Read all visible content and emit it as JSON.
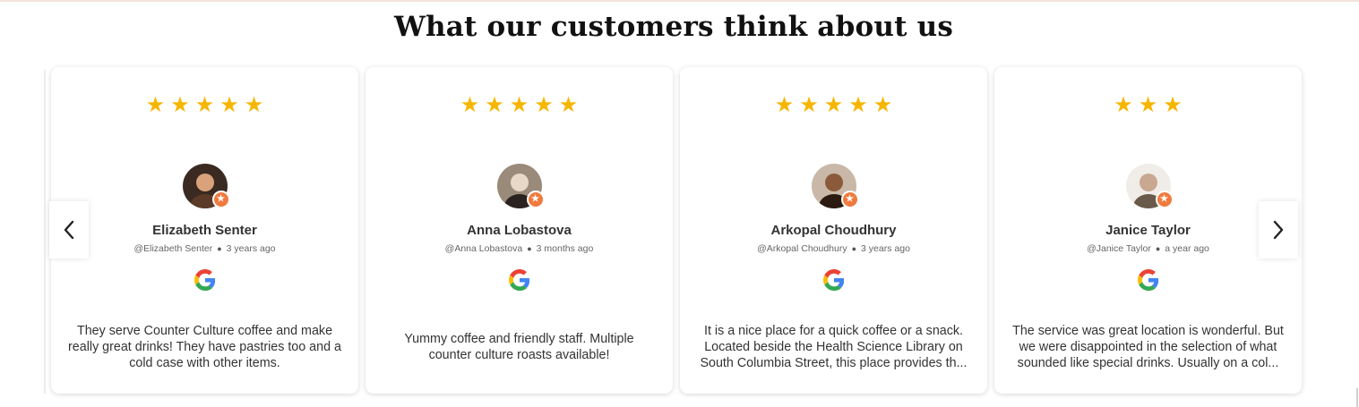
{
  "section": {
    "heading": "What our customers think about us"
  },
  "colors": {
    "star": "#f6b600",
    "badge": "#f07a3e"
  },
  "carousel": {
    "prev_icon": "chevron-left-icon",
    "next_icon": "chevron-right-icon"
  },
  "reviews": [
    {
      "rating": 5,
      "name": "Elizabeth Senter",
      "handle": "@Elizabeth Senter",
      "time": "3 years ago",
      "source_icon": "google-g-icon",
      "text": "They serve Counter Culture coffee and make really great drinks! They have pastries too and a cold case with other items."
    },
    {
      "rating": 5,
      "name": "Anna Lobastova",
      "handle": "@Anna Lobastova",
      "time": "3 months ago",
      "source_icon": "google-g-icon",
      "text": "Yummy coffee and friendly staff. Multiple counter culture roasts available!"
    },
    {
      "rating": 5,
      "name": "Arkopal Choudhury",
      "handle": "@Arkopal Choudhury",
      "time": "3 years ago",
      "source_icon": "google-g-icon",
      "text": "It is a nice place for a quick coffee or a snack. Located beside the Health Science Library on South Columbia Street, this place provides th..."
    },
    {
      "rating": 3,
      "name": "Janice Taylor",
      "handle": "@Janice Taylor",
      "time": "a year ago",
      "source_icon": "google-g-icon",
      "text": "The service was great location is wonderful. But we were disappointed in the selection of what sounded like special drinks. Usually on a col..."
    }
  ]
}
